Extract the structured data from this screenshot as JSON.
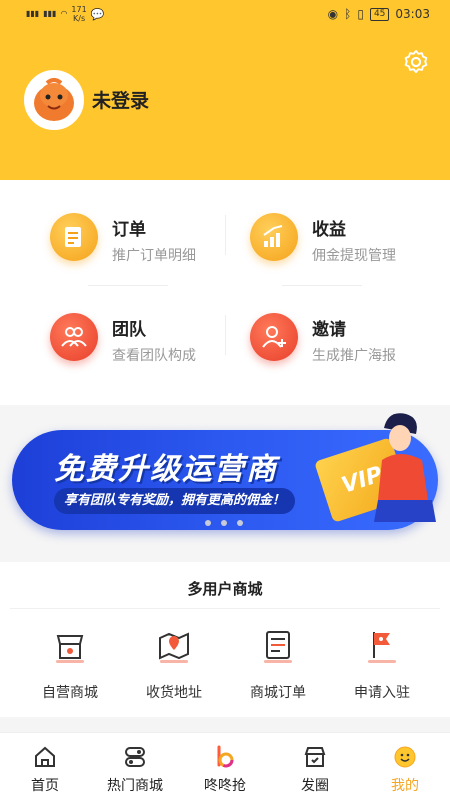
{
  "status_bar": {
    "net_speed_value": "171",
    "net_speed_unit": "K/s",
    "battery": "45",
    "time": "03:03"
  },
  "profile": {
    "login_text": "未登录"
  },
  "functions": [
    {
      "title": "订单",
      "subtitle": "推广订单明细",
      "icon": "order-icon"
    },
    {
      "title": "收益",
      "subtitle": "佣金提现管理",
      "icon": "earnings-icon"
    },
    {
      "title": "团队",
      "subtitle": "查看团队构成",
      "icon": "team-icon"
    },
    {
      "title": "邀请",
      "subtitle": "生成推广海报",
      "icon": "invite-icon"
    }
  ],
  "banner": {
    "title": "免费升级运营商",
    "subtitle": "享有团队专有奖励，拥有更高的佣金！",
    "badge": "VIP"
  },
  "mall": {
    "title": "多用户商城",
    "items": [
      {
        "label": "自营商城",
        "icon": "store-icon"
      },
      {
        "label": "收货地址",
        "icon": "map-pin-icon"
      },
      {
        "label": "商城订单",
        "icon": "order-list-icon"
      },
      {
        "label": "申请入驻",
        "icon": "flag-icon"
      }
    ]
  },
  "tabs": [
    {
      "label": "首页",
      "icon": "home-icon"
    },
    {
      "label": "热门商城",
      "icon": "toggle-icon"
    },
    {
      "label": "咚咚抢",
      "icon": "brand-b-icon"
    },
    {
      "label": "发圈",
      "icon": "shop-icon"
    },
    {
      "label": "我的",
      "icon": "smile-icon",
      "active": true
    }
  ],
  "colors": {
    "header_bg": "#ffc62d",
    "accent_orange": "#f5a623",
    "icon_red": "#f25a3a",
    "banner_blue": "#2c59f0"
  }
}
